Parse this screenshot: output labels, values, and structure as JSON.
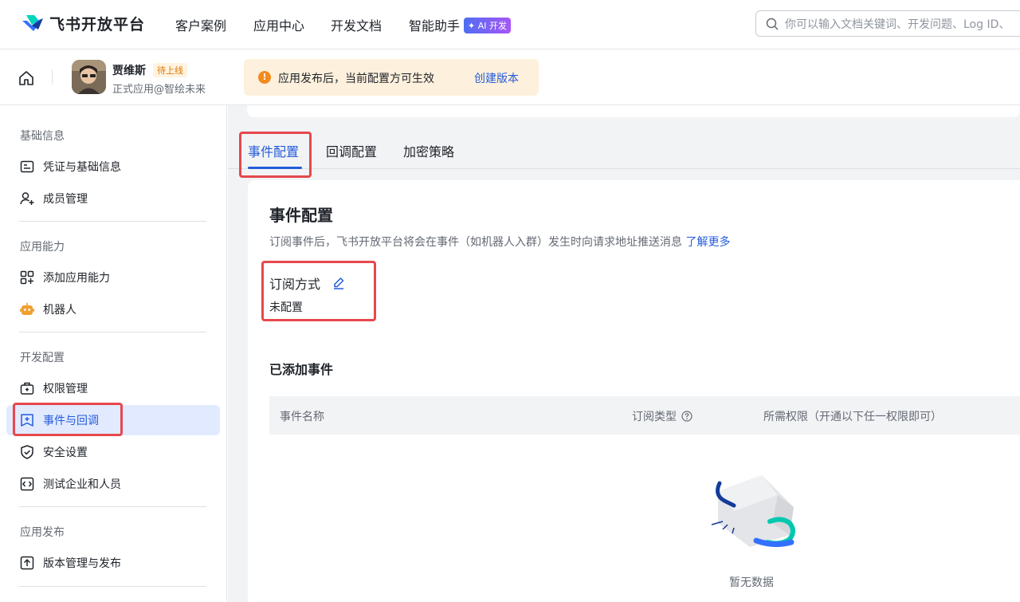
{
  "topnav": {
    "brand": "飞书开放平台",
    "items": [
      "客户案例",
      "应用中心",
      "开发文档",
      "智能助手"
    ],
    "ai_badge": "✦ AI 开发",
    "search_placeholder": "你可以输入文档关键词、开发问题、Log ID、"
  },
  "app": {
    "name": "贾维斯",
    "status": "待上线",
    "subtitle": "正式应用@智绘未来"
  },
  "notice": {
    "icon": "!",
    "text": "应用发布后，当前配置方可生效",
    "link": "创建版本"
  },
  "sidebar": {
    "sections": [
      {
        "title": "基础信息",
        "items": [
          "凭证与基础信息",
          "成员管理"
        ]
      },
      {
        "title": "应用能力",
        "items": [
          "添加应用能力",
          "机器人"
        ]
      },
      {
        "title": "开发配置",
        "items": [
          "权限管理",
          "事件与回调",
          "安全设置",
          "测试企业和人员"
        ]
      },
      {
        "title": "应用发布",
        "items": [
          "版本管理与发布"
        ]
      }
    ],
    "active_item": "事件与回调"
  },
  "tabs": [
    "事件配置",
    "回调配置",
    "加密策略"
  ],
  "card": {
    "title": "事件配置",
    "desc": "订阅事件后，飞书开放平台将会在事件（如机器人入群）发生时向请求地址推送消息",
    "desc_link": "了解更多",
    "subscription_label": "订阅方式",
    "subscription_value": "未配置",
    "events_title": "已添加事件",
    "columns": [
      "事件名称",
      "订阅类型",
      "所需权限（开通以下任一权限即可）"
    ],
    "empty_text": "暂无数据"
  },
  "colors": {
    "accent": "#245bdb",
    "highlight": "#e5484d",
    "warning": "#f58a1e"
  }
}
